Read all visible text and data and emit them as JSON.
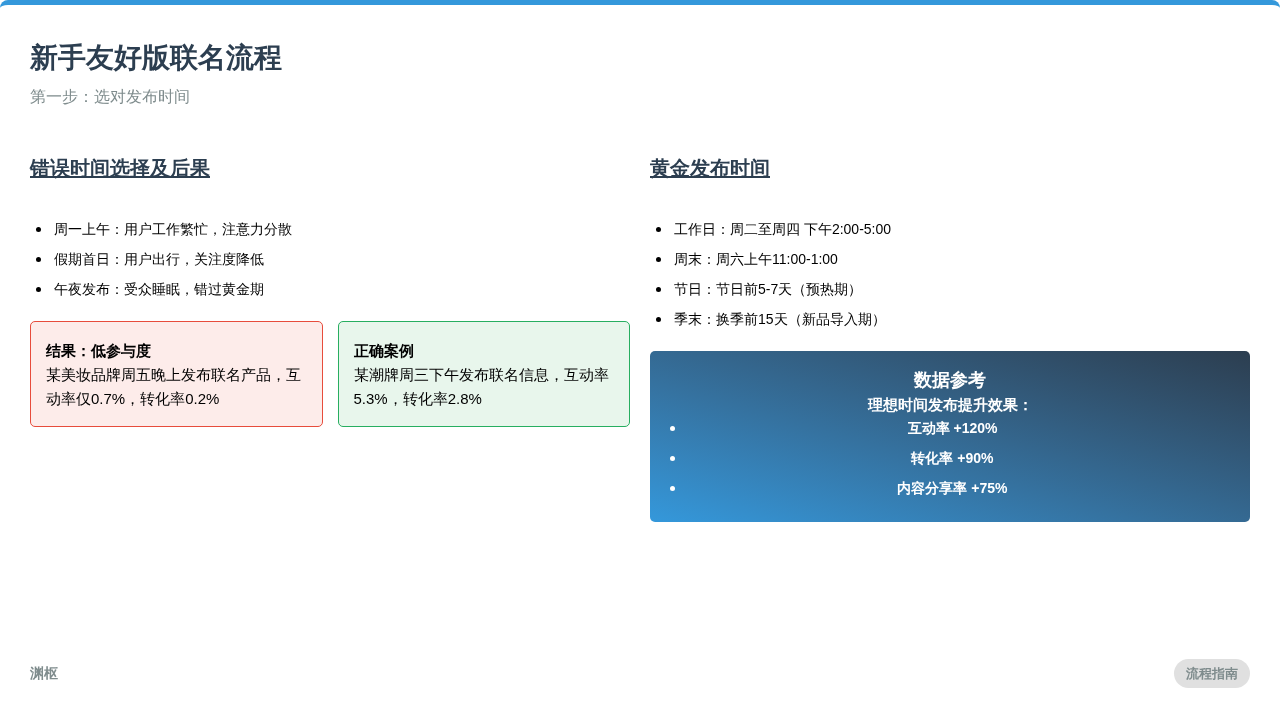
{
  "title": "新手友好版联名流程",
  "subtitle": "第一步：选对发布时间",
  "left": {
    "heading": "错误时间选择及后果",
    "items": [
      "周一上午：用户工作繁忙，注意力分散",
      "假期首日：用户出行，关注度降低",
      "午夜发布：受众睡眠，错过黄金期"
    ],
    "cards": [
      {
        "kind": "negative",
        "title": "结果：低参与度",
        "text": "某美妆品牌周五晚上发布联名产品，互动率仅0.7%，转化率0.2%"
      },
      {
        "kind": "positive",
        "title": "正确案例",
        "text": "某潮牌周三下午发布联名信息，互动率5.3%，转化率2.8%"
      }
    ]
  },
  "right": {
    "heading": "黄金发布时间",
    "items": [
      "工作日：周二至周四 下午2:00-5:00",
      "周末：周六上午11:00-1:00",
      "节日：节日前5-7天（预热期）",
      "季末：换季前15天（新品导入期）"
    ],
    "data_box": {
      "title": "数据参考",
      "subtitle": "理想时间发布提升效果：",
      "items": [
        "互动率 +120%",
        "转化率 +90%",
        "内容分享率 +75%"
      ]
    }
  },
  "footer": {
    "brand": "渊枢",
    "badge": "流程指南"
  }
}
